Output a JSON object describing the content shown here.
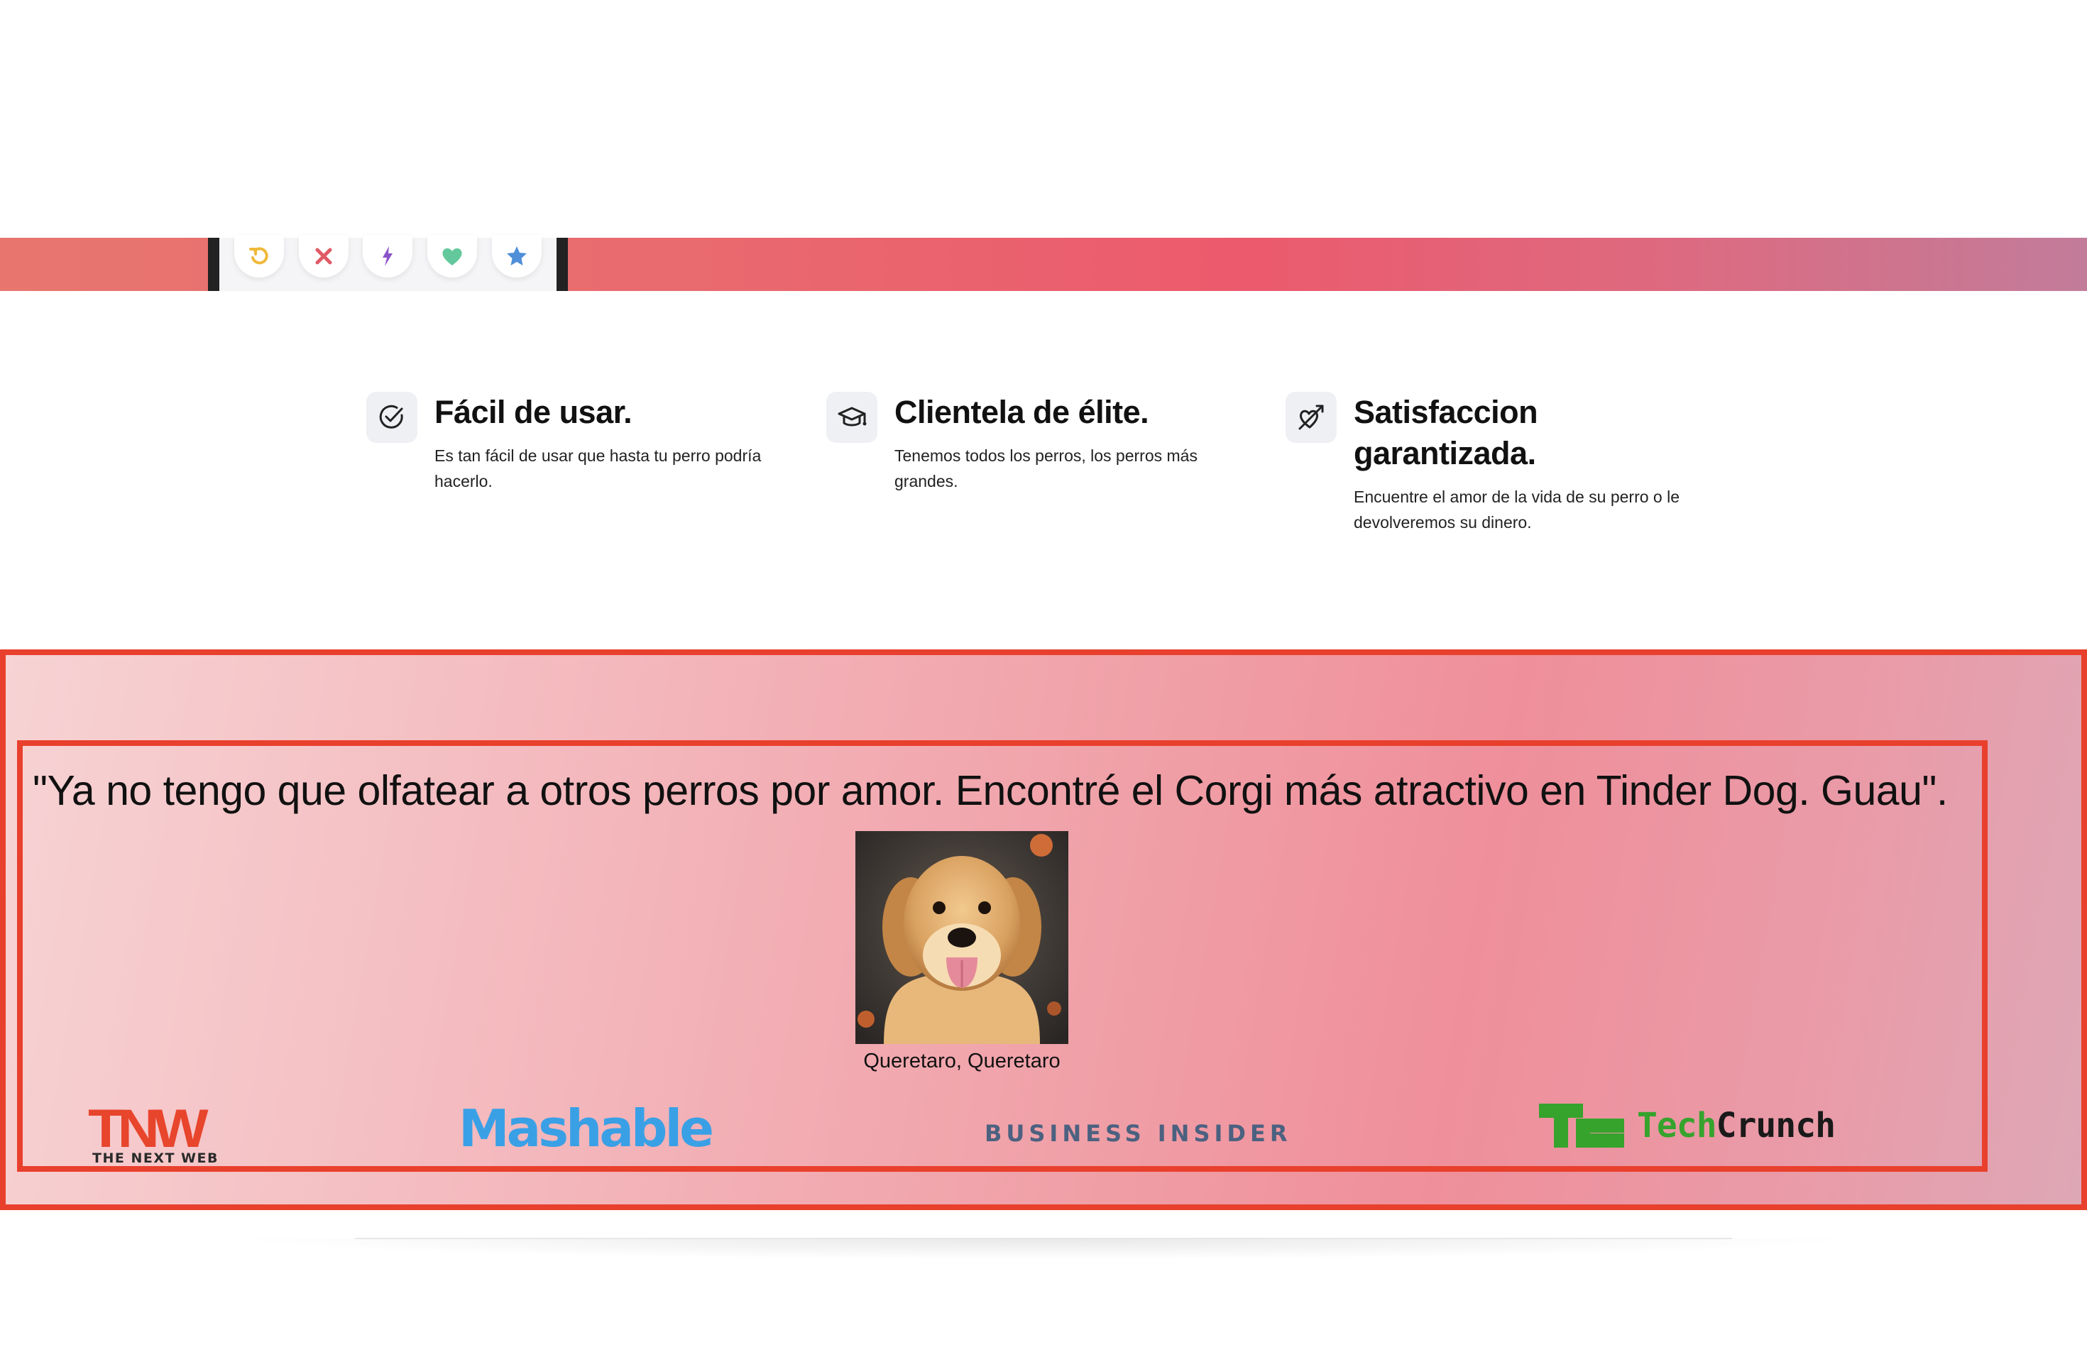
{
  "phone": {
    "actions": [
      {
        "name": "rewind-icon",
        "color": "#f0b93a"
      },
      {
        "name": "close-icon",
        "color": "#e05a66"
      },
      {
        "name": "lightning-icon",
        "color": "#8b52c9"
      },
      {
        "name": "heart-icon",
        "color": "#63c89b"
      },
      {
        "name": "star-icon",
        "color": "#4f8fd8"
      }
    ]
  },
  "features": [
    {
      "icon": "check-circle-icon",
      "title": "Fácil de usar.",
      "desc": "Es tan fácil de usar que hasta tu perro podría hacerlo."
    },
    {
      "icon": "graduation-cap-icon",
      "title": "Clientela de élite.",
      "desc": "Tenemos todos los perros, los perros más grandes."
    },
    {
      "icon": "heart-arrow-icon",
      "title": "Satisfaccion garantizada.",
      "desc": "Encuentre el amor de la vida de su perro o le devolveremos su dinero."
    }
  ],
  "testimonial": {
    "quote": "\"Ya no tengo que olfatear a otros perros por amor. Encontré el Corgi más atractivo en Tinder Dog. Guau\".",
    "location": "Queretaro, Queretaro"
  },
  "press": {
    "tnw_mark": "TNW",
    "tnw_sub": "THE NEXT WEB",
    "mashable": "Mashable",
    "business_insider": "BUSINESS INSIDER",
    "techcrunch_a": "Tech",
    "techcrunch_b": "Crunch"
  },
  "colors": {
    "accent_border": "#e8402c",
    "tnw": "#e8452d",
    "mashable": "#3aa0e6",
    "business_insider": "#4c6180",
    "techcrunch": "#36a32d"
  }
}
